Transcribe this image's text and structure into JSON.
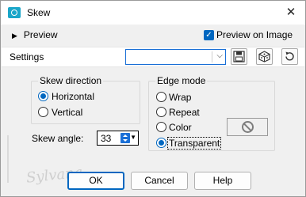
{
  "titlebar": {
    "title": "Skew",
    "close_glyph": "✕"
  },
  "preview": {
    "label": "Preview",
    "arrow": "▶"
  },
  "preview_on_image": {
    "label": "Preview on Image",
    "checked": true
  },
  "settings": {
    "label": "Settings",
    "value": ""
  },
  "skew_direction": {
    "title": "Skew direction",
    "options": [
      {
        "label": "Horizontal",
        "checked": true
      },
      {
        "label": "Vertical",
        "checked": false
      }
    ]
  },
  "skew_angle": {
    "label": "Skew angle:",
    "value": "33"
  },
  "edge_mode": {
    "title": "Edge mode",
    "options": [
      {
        "label": "Wrap",
        "checked": false
      },
      {
        "label": "Repeat",
        "checked": false
      },
      {
        "label": "Color",
        "checked": false
      },
      {
        "label": "Transparent",
        "checked": true
      }
    ]
  },
  "buttons": {
    "ok": "OK",
    "cancel": "Cancel",
    "help": "Help"
  },
  "watermark": {
    "text": "Sylvana"
  },
  "colors": {
    "accent": "#0067c0",
    "app_icon": "#1aa6c9"
  }
}
